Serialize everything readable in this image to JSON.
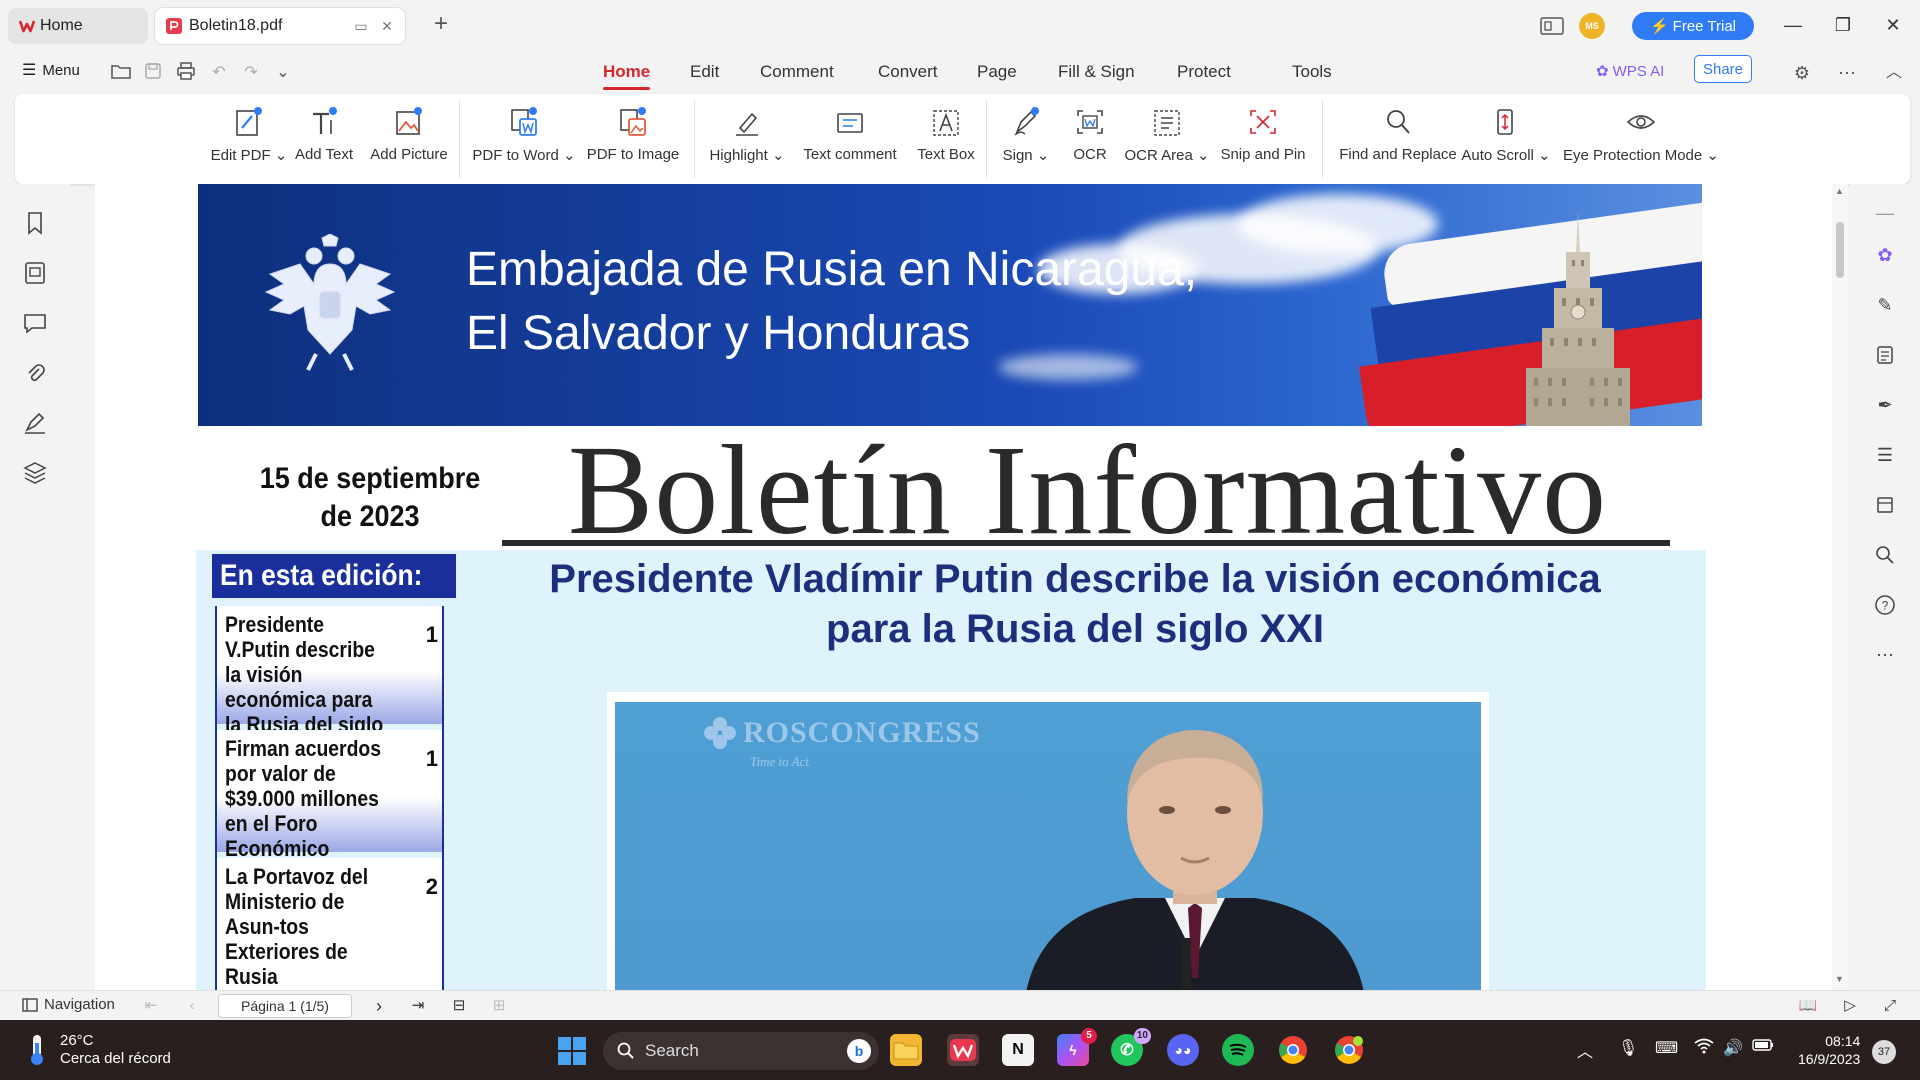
{
  "tabs": [
    {
      "label": "Home",
      "icon": "wps-icon"
    },
    {
      "label": "Boletin18.pdf",
      "icon": "pdf-icon"
    }
  ],
  "titlebar": {
    "avatar_initials": "MS",
    "free_trial_label": "Free Trial"
  },
  "menu": {
    "menu_label": "Menu",
    "nav": [
      "Home",
      "Edit",
      "Comment",
      "Convert",
      "Page",
      "Fill & Sign",
      "Protect",
      "Tools"
    ],
    "active": "Home",
    "wps_ai_label": "WPS AI",
    "share_label": "Share"
  },
  "ribbon": [
    {
      "label": "Edit PDF",
      "dropdown": true
    },
    {
      "label": "Add Text",
      "dropdown": false
    },
    {
      "label": "Add Picture",
      "dropdown": false
    },
    {
      "label": "PDF to Word",
      "dropdown": true
    },
    {
      "label": "PDF to Image",
      "dropdown": false
    },
    {
      "label": "Highlight",
      "dropdown": true
    },
    {
      "label": "Text comment",
      "dropdown": false
    },
    {
      "label": "Text Box",
      "dropdown": false
    },
    {
      "label": "Sign",
      "dropdown": true
    },
    {
      "label": "OCR",
      "dropdown": false
    },
    {
      "label": "OCR Area",
      "dropdown": true
    },
    {
      "label": "Snip and Pin",
      "dropdown": false
    },
    {
      "label": "Find and Replace",
      "dropdown": false
    },
    {
      "label": "Auto Scroll",
      "dropdown": true
    },
    {
      "label": "Eye Protection Mode",
      "dropdown": true
    }
  ],
  "document": {
    "banner_line1": "Embajada de Rusia en Nicaragua,",
    "banner_line2": "El Salvador y Honduras",
    "date_line1": "15 de septiembre",
    "date_line2": "de 2023",
    "masthead": "Boletín Informativo",
    "toc_heading": "En esta edición:",
    "toc": [
      {
        "text": "Presidente V.Putin describe la visión económica para la Rusia del siglo XXI",
        "page": "1"
      },
      {
        "text": "Firman acuerdos por valor de $39.000 millones en el Foro Económico Oriental",
        "page": "1"
      },
      {
        "text": "La Portavoz del Ministerio de Asun-tos Exteriores de Rusia M.Zajárova: Rusia se muestra",
        "page": "2"
      }
    ],
    "headline_line1": "Presidente Vladímir Putin describe la visión económica",
    "headline_line2": "para la Rusia del siglo XXI",
    "photo_logo": "ROSCONGRESS",
    "photo_tagline": "Time to Act"
  },
  "statusbar": {
    "navigation_label": "Navigation",
    "page_indicator": "Página 1 (1/5)"
  },
  "taskbar": {
    "temperature": "26°C",
    "weather_desc": "Cerca del récord",
    "search_label": "Search",
    "time": "08:14",
    "date": "16/9/2023",
    "notification_count": "37",
    "badges": {
      "messenger": "5",
      "whatsapp": "10"
    }
  },
  "colors": {
    "accent_red": "#d4262c",
    "accent_blue": "#2f7cf6",
    "headline_blue": "#1b2f7c",
    "toc_blue": "#1b2f9c"
  }
}
